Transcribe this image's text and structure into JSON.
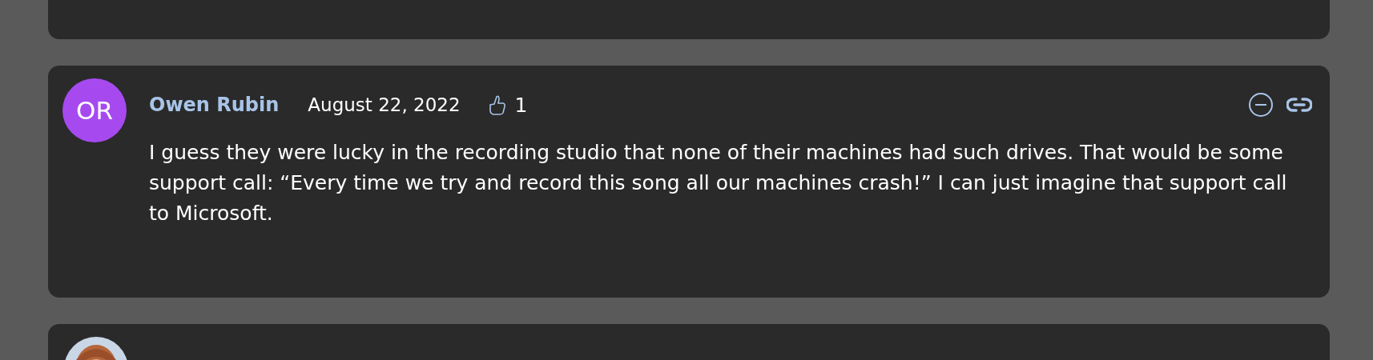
{
  "comments": [
    {
      "kind": "cut_top"
    },
    {
      "kind": "full",
      "author": "Owen Rubin",
      "initials": "OR",
      "color": "#a64af0",
      "date": "August 22, 2022",
      "likes": "1",
      "body": "I guess they were lucky in the recording studio that none of their machines had such drives. That would be some support call: “Every time we try and record this song all our machines crash!” I can just imagine that support call to Microsoft."
    },
    {
      "kind": "cut_bottom"
    }
  ]
}
